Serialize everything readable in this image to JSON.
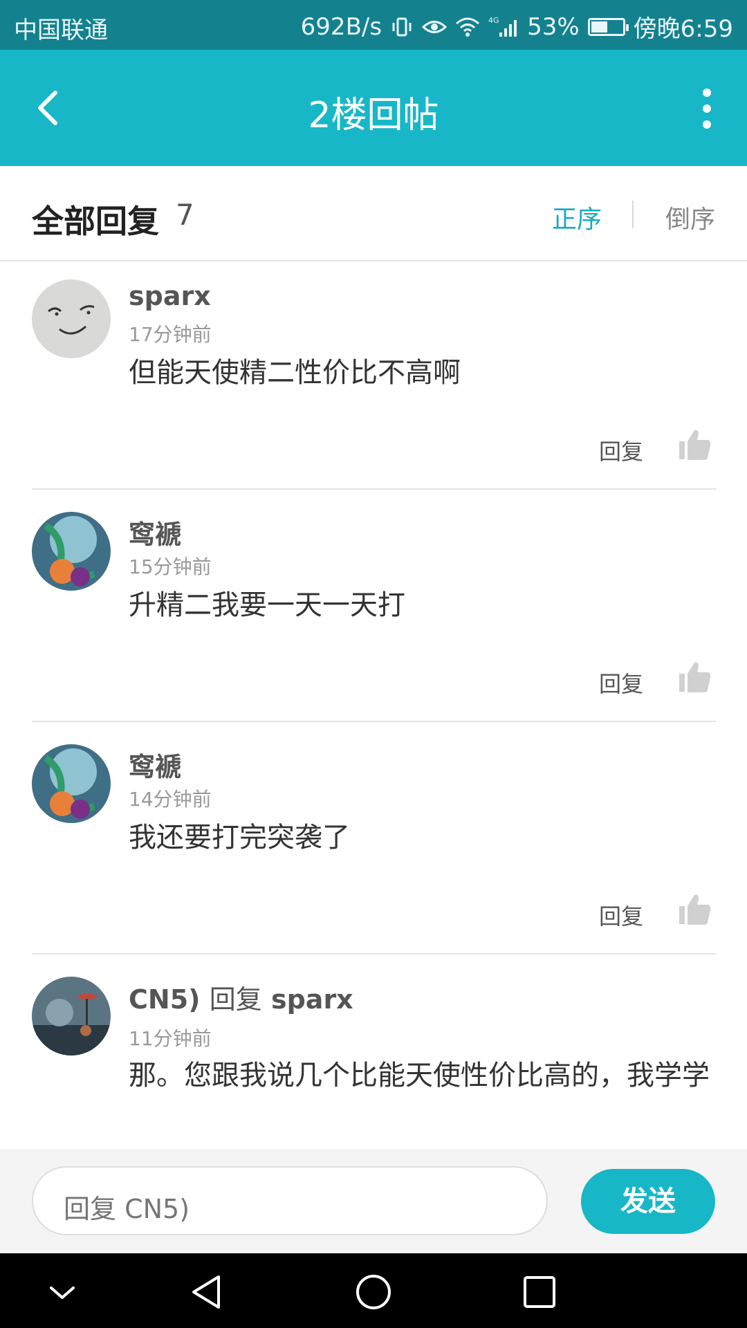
{
  "status_bar": {
    "carrier": "中国联通",
    "speed": "692B/s",
    "network": "4G",
    "battery": "53%",
    "battery_level": 0.53,
    "time": "傍晚6:59"
  },
  "app_bar": {
    "title": "2楼回帖"
  },
  "sort_bar": {
    "label": "全部回复",
    "count": "7",
    "ascending": "正序",
    "descending": "倒序"
  },
  "comments": [
    {
      "user": "sparx",
      "reply_to": "",
      "time": "17分钟前",
      "text": "但能天使精二性价比不高啊",
      "reply_label": "回复"
    },
    {
      "user": "窎褫",
      "reply_to": "",
      "time": "15分钟前",
      "text": "升精二我要一天一天打",
      "reply_label": "回复"
    },
    {
      "user": "窎褫",
      "reply_to": "",
      "time": "14分钟前",
      "text": "我还要打完突袭了",
      "reply_label": "回复"
    },
    {
      "user": "CN5)",
      "reply_word": "回复",
      "reply_to": "sparx",
      "time": "11分钟前",
      "text": "那。您跟我说几个比能天使性价比高的，我学学"
    }
  ],
  "input_bar": {
    "placeholder": "回复 CN5)",
    "send_label": "发送"
  },
  "colors": {
    "accent": "#18b7c7",
    "status_bar": "#14818f"
  }
}
